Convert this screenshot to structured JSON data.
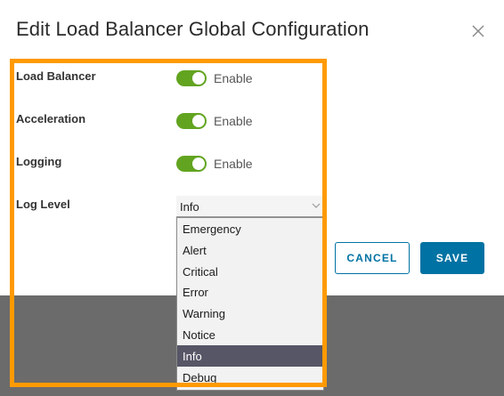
{
  "dialog": {
    "title": "Edit Load Balancer Global Configuration"
  },
  "settings": [
    {
      "label": "Load Balancer",
      "toggle_text": "Enable",
      "enabled": true
    },
    {
      "label": "Acceleration",
      "toggle_text": "Enable",
      "enabled": true
    },
    {
      "label": "Logging",
      "toggle_text": "Enable",
      "enabled": true
    }
  ],
  "log_level": {
    "label": "Log Level",
    "selected": "Info",
    "options": [
      "Emergency",
      "Alert",
      "Critical",
      "Error",
      "Warning",
      "Notice",
      "Info",
      "Debug"
    ]
  },
  "buttons": {
    "cancel_label": "CANCEL",
    "save_label": "SAVE"
  },
  "colors": {
    "toggle_on": "#62a420",
    "primary": "#0072a3",
    "highlight": "#ff9a00",
    "selected_option": "#565666"
  },
  "icons": {
    "close": "close-icon",
    "dropdown": "chevron-down-icon"
  }
}
